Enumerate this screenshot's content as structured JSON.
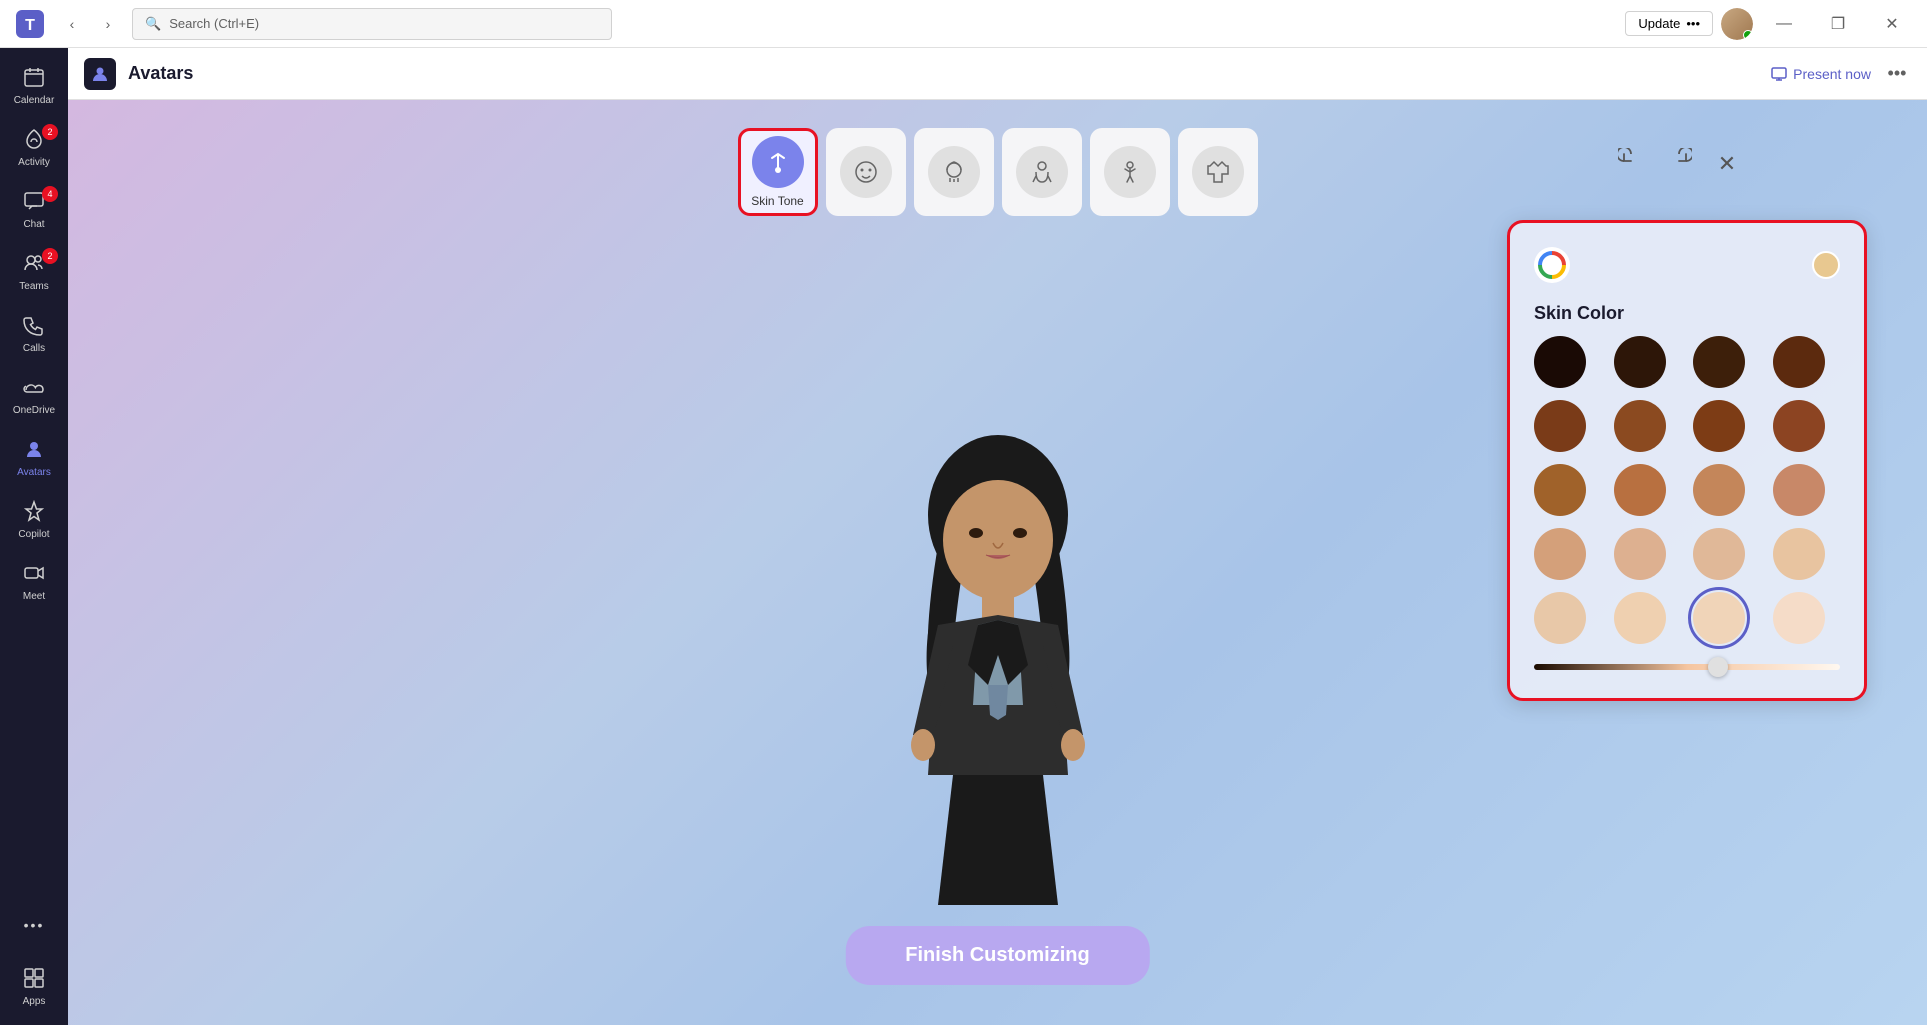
{
  "titlebar": {
    "logo": "⬡",
    "search_placeholder": "Search (Ctrl+E)",
    "update_label": "Update",
    "update_dots": "•••",
    "minimize": "—",
    "maximize": "❐",
    "close": "✕"
  },
  "sidebar": {
    "items": [
      {
        "id": "calendar",
        "label": "Calendar",
        "icon": "▦",
        "badge": null,
        "active": false
      },
      {
        "id": "activity",
        "label": "Activity",
        "icon": "🔔",
        "badge": "2",
        "active": false
      },
      {
        "id": "chat",
        "label": "Chat",
        "icon": "💬",
        "badge": "4",
        "active": false
      },
      {
        "id": "teams",
        "label": "Teams",
        "icon": "⬡⬡",
        "badge": "2",
        "active": false
      },
      {
        "id": "calls",
        "label": "Calls",
        "icon": "📞",
        "badge": null,
        "active": false
      },
      {
        "id": "onedrive",
        "label": "OneDrive",
        "icon": "☁",
        "badge": null,
        "active": false
      },
      {
        "id": "avatars",
        "label": "Avatars",
        "icon": "👤",
        "badge": null,
        "active": true
      },
      {
        "id": "copilot",
        "label": "Copilot",
        "icon": "⚡",
        "badge": null,
        "active": false
      },
      {
        "id": "meet",
        "label": "Meet",
        "icon": "🎥",
        "badge": null,
        "active": false
      },
      {
        "id": "more",
        "label": "•••",
        "icon": "•••",
        "badge": null,
        "active": false
      },
      {
        "id": "apps",
        "label": "Apps",
        "icon": "⊞",
        "badge": null,
        "active": false
      }
    ]
  },
  "page": {
    "title": "Avatars",
    "present_label": "Present now",
    "more_label": "•••"
  },
  "toolbar": {
    "items": [
      {
        "id": "skin-tone",
        "label": "Skin Tone",
        "active": true,
        "icon": "palette"
      },
      {
        "id": "face",
        "label": "",
        "active": false,
        "icon": "face"
      },
      {
        "id": "hair",
        "label": "",
        "active": false,
        "icon": "hair"
      },
      {
        "id": "body",
        "label": "",
        "active": false,
        "icon": "body"
      },
      {
        "id": "pose",
        "label": "",
        "active": false,
        "icon": "pose"
      },
      {
        "id": "outfit",
        "label": "",
        "active": false,
        "icon": "outfit"
      }
    ],
    "undo_label": "undo",
    "redo_label": "redo",
    "close_label": "close"
  },
  "skin_panel": {
    "title": "Skin Color",
    "colors": [
      "#1a0a05",
      "#2d1608",
      "#3d1f0a",
      "#5c2a0e",
      "#7a3b18",
      "#8b4a20",
      "#7d3c15",
      "#8c4422",
      "#a0622a",
      "#b87040",
      "#c4865a",
      "#c88868",
      "#d4a07a",
      "#ddb090",
      "#e0b898",
      "#e8c4a0",
      "#e8c8a8",
      "#efd0b0",
      "#f0d4b8",
      "#f5dcc8"
    ],
    "selected_color": "#f0d0b0",
    "slider_value": 60
  },
  "finish_btn": {
    "label": "Finish Customizing"
  }
}
